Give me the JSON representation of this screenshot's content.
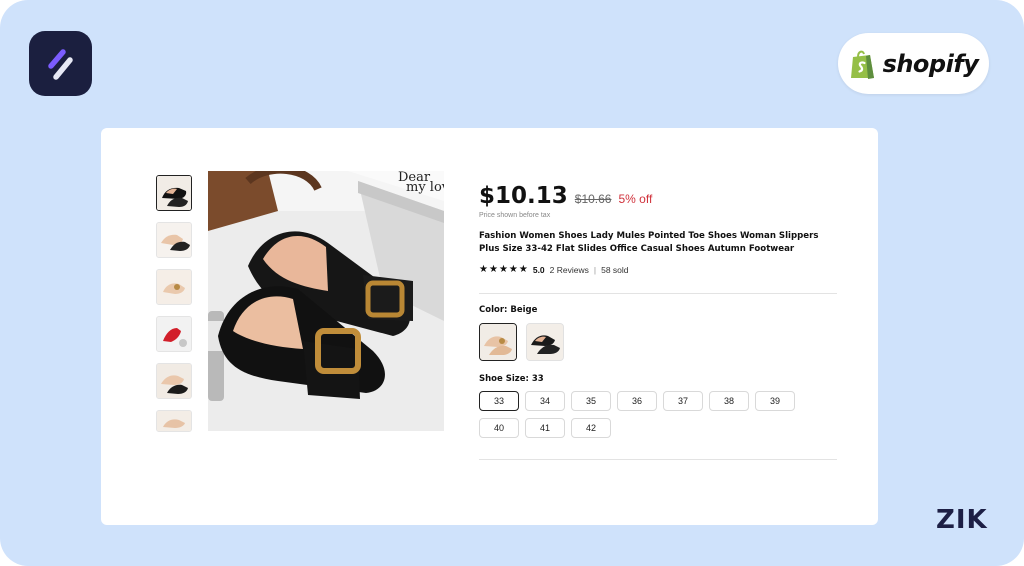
{
  "branding": {
    "shopify_label": "shopify",
    "corner_mark": "ZIK",
    "background_color": "#cfe2fb",
    "app_logo_color": "#1b1f3f"
  },
  "product": {
    "image_brand": {
      "line1": "Dear",
      "line2": "my love"
    },
    "price": "$10.13",
    "original_price": "$10.66",
    "discount": "5% off",
    "tax_note": "Price shown before tax",
    "title": "Fashion Women Shoes Lady Mules Pointed Toe Shoes Woman Slippers Plus Size 33-42 Flat Slides Office Casual Shoes Autumn Footwear",
    "rating": {
      "stars": 5,
      "value": "5.0",
      "reviews": "2 Reviews",
      "separator": "|",
      "sold": "58 sold"
    },
    "color": {
      "label": "Color: Beige",
      "options": [
        "beige-swatch",
        "black-swatch"
      ]
    },
    "size": {
      "label": "Shoe Size: 33",
      "options": [
        "33",
        "34",
        "35",
        "36",
        "37",
        "38",
        "39",
        "40",
        "41",
        "42"
      ]
    },
    "colors": {
      "discount": "#d0313b",
      "selected_border": "#222222"
    }
  }
}
